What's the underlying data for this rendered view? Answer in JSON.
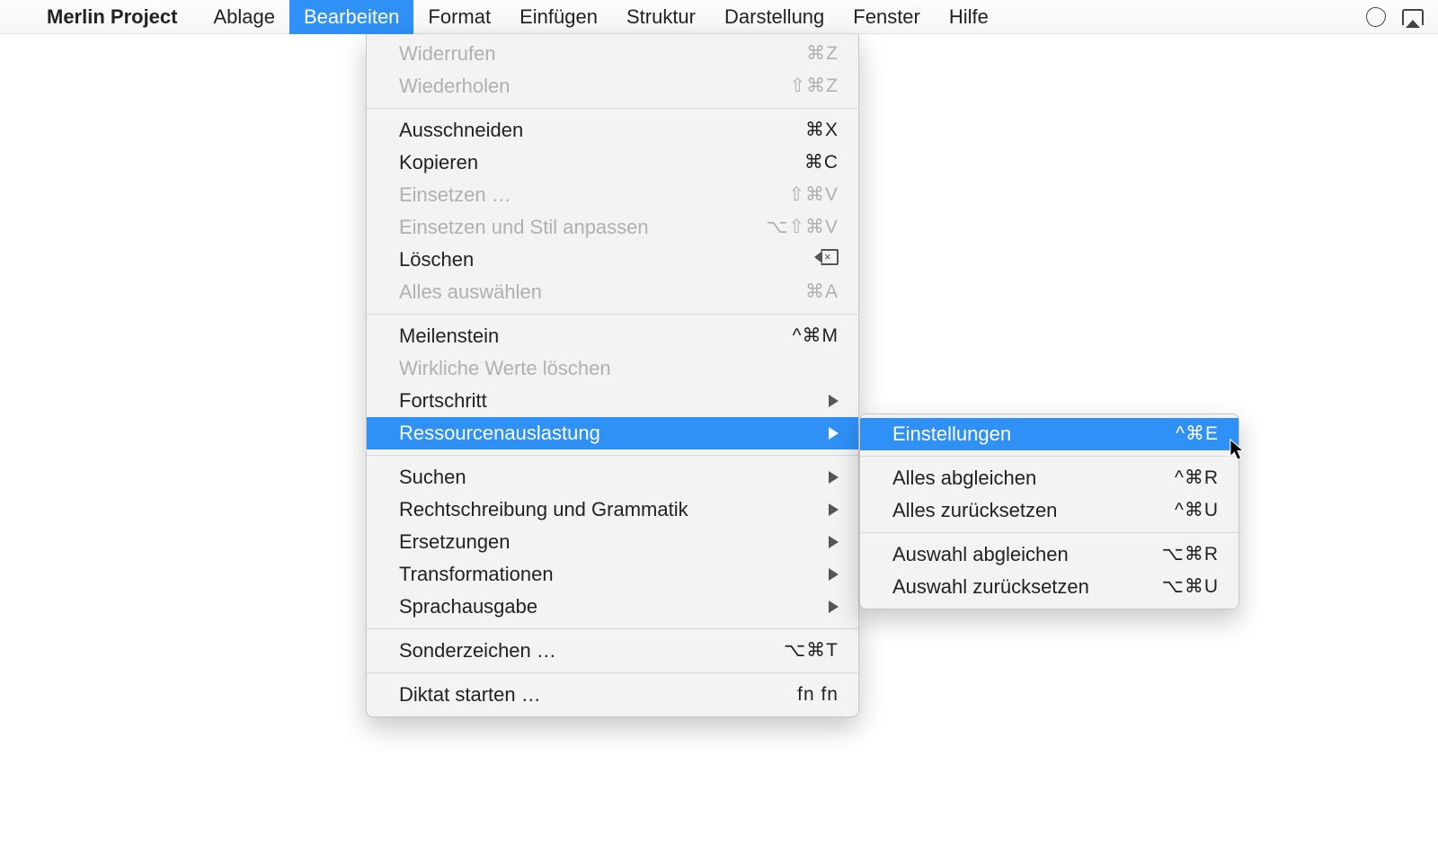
{
  "menubar": {
    "app_name": "Merlin Project",
    "items": [
      "Ablage",
      "Bearbeiten",
      "Format",
      "Einfügen",
      "Struktur",
      "Darstellung",
      "Fenster",
      "Hilfe"
    ],
    "active_index": 1
  },
  "edit_menu": {
    "groups": [
      [
        {
          "label": "Widerrufen",
          "shortcut": "⌘Z",
          "disabled": true
        },
        {
          "label": "Wiederholen",
          "shortcut": "⇧⌘Z",
          "disabled": true
        }
      ],
      [
        {
          "label": "Ausschneiden",
          "shortcut": "⌘X"
        },
        {
          "label": "Kopieren",
          "shortcut": "⌘C"
        },
        {
          "label": "Einsetzen …",
          "shortcut": "⇧⌘V",
          "disabled": true
        },
        {
          "label": "Einsetzen und Stil anpassen",
          "shortcut": "⌥⇧⌘V",
          "disabled": true
        },
        {
          "label": "Löschen",
          "shortcut_icon": "backspace"
        },
        {
          "label": "Alles auswählen",
          "shortcut": "⌘A",
          "disabled": true
        }
      ],
      [
        {
          "label": "Meilenstein",
          "shortcut": "^⌘M"
        },
        {
          "label": "Wirkliche Werte löschen",
          "disabled": true
        },
        {
          "label": "Fortschritt",
          "submenu": true
        },
        {
          "label": "Ressourcenauslastung",
          "submenu": true,
          "highlight": true
        }
      ],
      [
        {
          "label": "Suchen",
          "submenu": true
        },
        {
          "label": "Rechtschreibung und Grammatik",
          "submenu": true
        },
        {
          "label": "Ersetzungen",
          "submenu": true
        },
        {
          "label": "Transformationen",
          "submenu": true
        },
        {
          "label": "Sprachausgabe",
          "submenu": true
        }
      ],
      [
        {
          "label": "Sonderzeichen …",
          "shortcut": "⌥⌘T"
        }
      ],
      [
        {
          "label": "Diktat starten …",
          "shortcut": "fn fn"
        }
      ]
    ]
  },
  "sub_menu": {
    "groups": [
      [
        {
          "label": "Einstellungen",
          "shortcut": "^⌘E",
          "highlight": true
        }
      ],
      [
        {
          "label": "Alles abgleichen",
          "shortcut": "^⌘R"
        },
        {
          "label": "Alles zurücksetzen",
          "shortcut": "^⌘U"
        }
      ],
      [
        {
          "label": "Auswahl abgleichen",
          "shortcut": "⌥⌘R"
        },
        {
          "label": "Auswahl zurücksetzen",
          "shortcut": "⌥⌘U"
        }
      ]
    ]
  }
}
